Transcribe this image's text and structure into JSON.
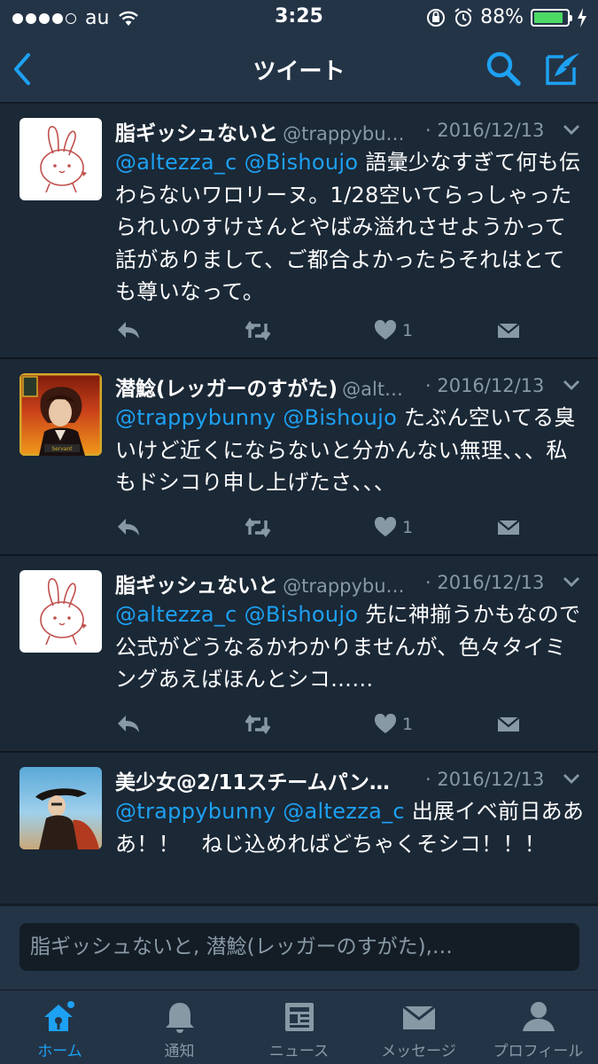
{
  "status_bar": {
    "carrier": "au",
    "time": "3:25",
    "battery": "88%",
    "battery_level": 0.88
  },
  "nav": {
    "title": "ツイート",
    "back_icon": "chevron-left-icon",
    "search_icon": "search-icon",
    "compose_icon": "compose-icon"
  },
  "tweets": [
    {
      "name": "脂ギッシュないと",
      "handle": "@trappybu…",
      "date": "· 2016/12/13",
      "mentions": "@altezza_c @Bishoujo",
      "text": " 語彙少なすぎて何も伝わらないワロリーヌ。1/28空いてらっしゃったられいのすけさんとやばみ溢れさせようかって話がありまして、ご都合よかったらそれはとても尊いなって。",
      "likes": "1"
    },
    {
      "name": "潜鯰(レッガーのすがた)",
      "handle": "@alt…",
      "date": "· 2016/12/13",
      "mentions": "@trappybunny @Bishoujo",
      "text": " たぶん空いてる臭いけど近くにならないと分かんない無理、、、私もドシコり申し上げたさ、、、",
      "likes": "1",
      "avatar_badge": "Servant"
    },
    {
      "name": "脂ギッシュないと",
      "handle": "@trappybu…",
      "date": "· 2016/12/13",
      "mentions": "@altezza_c @Bishoujo",
      "text": " 先に神揃うかもなので公式がどうなるかわかりませんが、色々タイミングあえばほんとシコ……",
      "likes": "1"
    },
    {
      "name": "美少女@2/11スチームパン…",
      "handle": "",
      "date": "· 2016/12/13",
      "mentions": "@trappybunny @altezza_c",
      "text": " 出展イベ前日あああ！！　ねじ込めればどちゃくそシコ！！！",
      "likes": ""
    }
  ],
  "reply": {
    "placeholder": "脂ギッシュないと, 潜鯰(レッガーのすがた),…"
  },
  "tabs": [
    {
      "label": "ホーム",
      "icon": "home-icon",
      "active": true
    },
    {
      "label": "通知",
      "icon": "bell-icon",
      "active": false
    },
    {
      "label": "ニュース",
      "icon": "news-icon",
      "active": false
    },
    {
      "label": "メッセージ",
      "icon": "envelope-icon",
      "active": false
    },
    {
      "label": "プロフィール",
      "icon": "person-icon",
      "active": false
    }
  ],
  "colors": {
    "background": "#141d26",
    "bar": "#243447",
    "tweet_bg": "#1b2836",
    "accent": "#1da1f2",
    "muted": "#8899a6",
    "battery": "#4cd964"
  }
}
